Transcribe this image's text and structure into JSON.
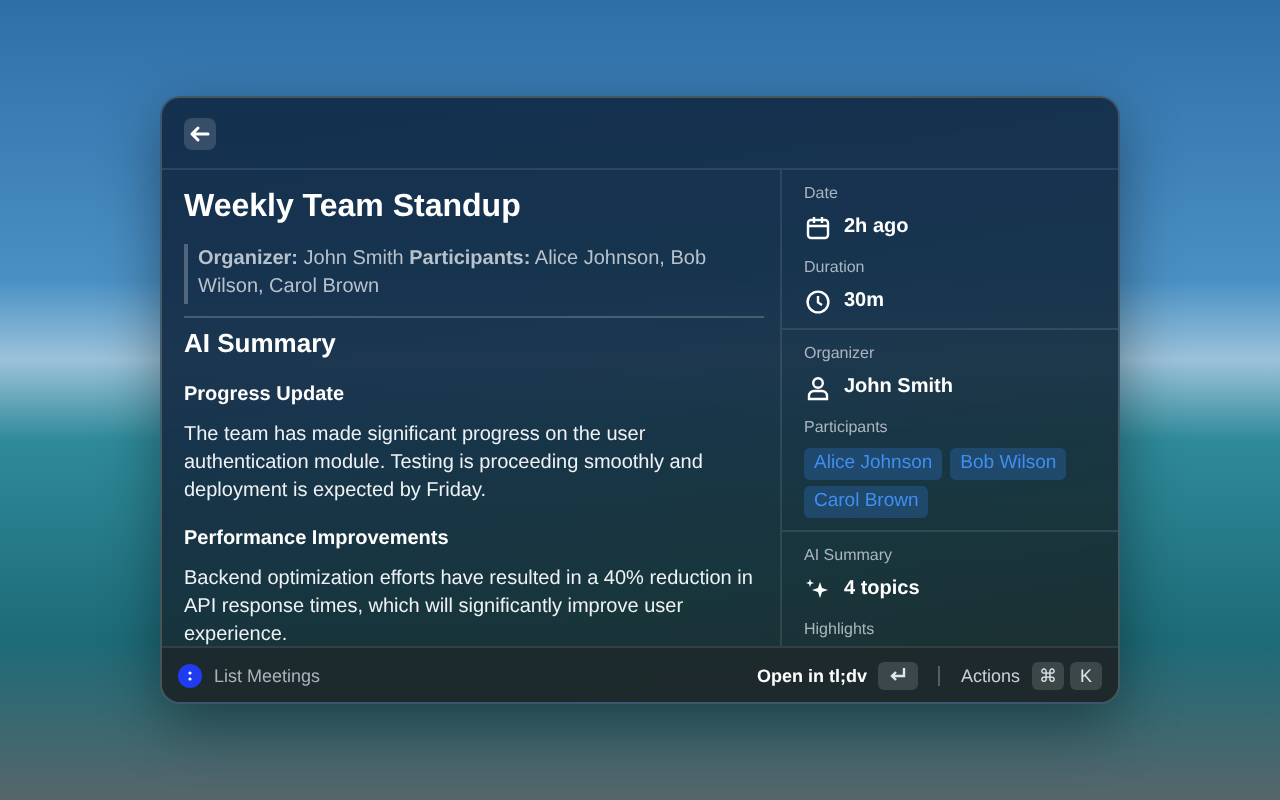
{
  "meeting": {
    "title": "Weekly Team Standup",
    "meta": "**Organizer:** John Smith **Participants:** Alice Johnson, Bob Wilson, Carol Brown"
  },
  "summary": {
    "heading": "AI Summary",
    "sections": [
      {
        "heading": "Progress Update",
        "text": "The team has made significant progress on the user authentication module. Testing is proceeding smoothly and deployment is expected by Friday."
      },
      {
        "heading": "Performance Improvements",
        "text": "Backend optimization efforts have resulted in a 40% reduction in API response times, which will significantly improve user experience."
      }
    ]
  },
  "details": {
    "groups": [
      {
        "fields": [
          {
            "label": "Date",
            "kind": "date",
            "value": "2h ago"
          },
          {
            "label": "Duration",
            "kind": "duration",
            "value": "30m"
          }
        ]
      },
      {
        "fields": [
          {
            "label": "Organizer",
            "kind": "person",
            "value": "John Smith"
          },
          {
            "label": "Participants",
            "kind": "tags",
            "tags": [
              "Alice Johnson",
              "Bob Wilson",
              "Carol Brown"
            ]
          }
        ]
      },
      {
        "fields": [
          {
            "label": "AI Summary",
            "kind": "topics",
            "value": "4 topics"
          },
          {
            "label": "Highlights",
            "kind": "label"
          }
        ]
      }
    ]
  },
  "footer": {
    "title": "List Meetings",
    "primary_action": "Open in tl;dv",
    "actions_label": "Actions",
    "shortcut_keys": [
      "⌘",
      "K"
    ]
  }
}
